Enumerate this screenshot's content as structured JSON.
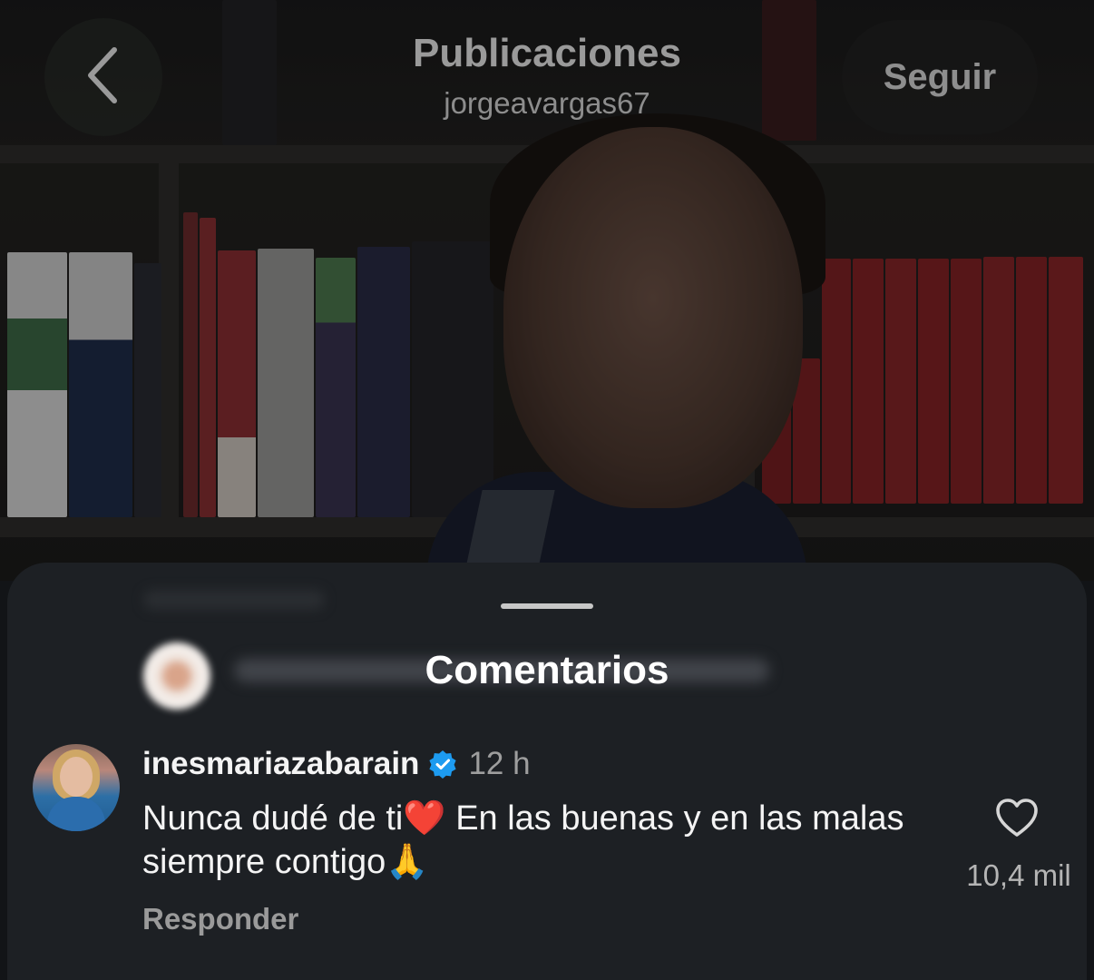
{
  "header": {
    "title": "Publicaciones",
    "username": "jorgeavargas67",
    "follow_label": "Seguir"
  },
  "comments_sheet": {
    "title": "Comentarios"
  },
  "comment": {
    "username": "inesmariazabarain",
    "time": "12 h",
    "text": "Nunca dudé de ti❤️ En las buenas y en las malas siempre contigo🙏",
    "reply_label": "Responder",
    "likes": "10,4 mil"
  },
  "icons": {
    "back": "chevron-left-icon",
    "verified": "verified-badge-icon",
    "like": "heart-outline-icon"
  },
  "colors": {
    "verified": "#1d9bf0",
    "sheet_bg": "#1d2024"
  }
}
